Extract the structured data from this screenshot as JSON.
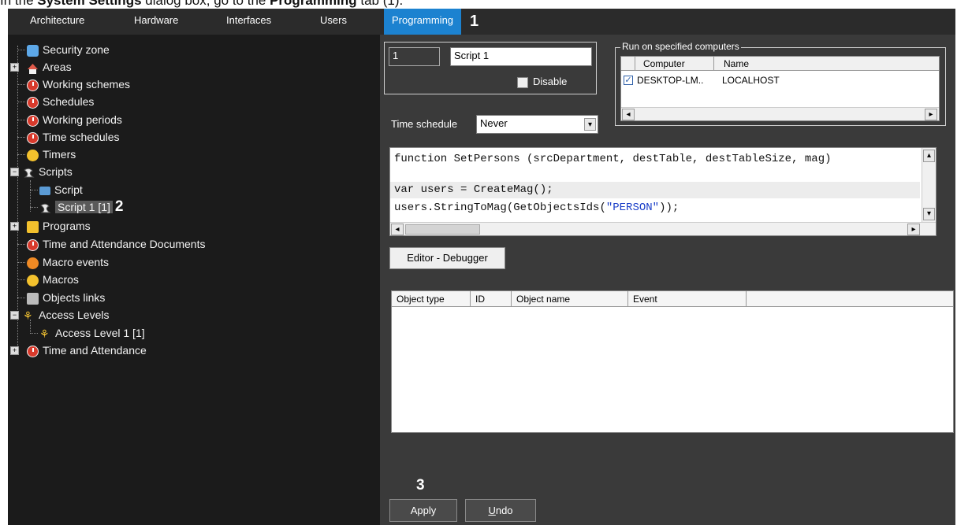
{
  "caption": {
    "prefix": "In the ",
    "dialog_name": "System Settings",
    "middle": " dialog box, go to the ",
    "tab_name": "Programming",
    "suffix": " tab (1)."
  },
  "tabs": [
    {
      "label": "Architecture"
    },
    {
      "label": "Hardware"
    },
    {
      "label": "Interfaces"
    },
    {
      "label": "Users"
    },
    {
      "label": "Programming",
      "active": true
    }
  ],
  "markers": {
    "tab": "1",
    "tree": "2",
    "apply": "3"
  },
  "tree": {
    "items": [
      {
        "label": "Security zone",
        "icon": "security-zone-icon"
      },
      {
        "label": "Areas",
        "icon": "areas-icon"
      },
      {
        "label": "Working schemes",
        "icon": "clock-icon"
      },
      {
        "label": "Schedules",
        "icon": "clock-icon"
      },
      {
        "label": "Working periods",
        "icon": "clock-icon"
      },
      {
        "label": "Time schedules",
        "icon": "clock-icon"
      },
      {
        "label": "Timers",
        "icon": "timer-icon"
      },
      {
        "label": "Scripts",
        "icon": "script-icon"
      },
      {
        "label": "Script",
        "icon": "folder-icon"
      },
      {
        "label": "Script 1 [1]",
        "icon": "script-icon",
        "selected": true
      },
      {
        "label": "Programs",
        "icon": "programs-icon"
      },
      {
        "label": "Time and Attendance Documents",
        "icon": "clock-icon"
      },
      {
        "label": "Macro events",
        "icon": "macro-event-icon"
      },
      {
        "label": "Macros",
        "icon": "macro-icon"
      },
      {
        "label": "Objects links",
        "icon": "link-icon"
      },
      {
        "label": "Access Levels",
        "icon": "access-icon"
      },
      {
        "label": "Access Level 1 [1]",
        "icon": "access-icon"
      },
      {
        "label": "Time and Attendance",
        "icon": "clock-icon"
      }
    ]
  },
  "form": {
    "id_value": "1",
    "name_value": "Script 1",
    "disable_label": "Disable",
    "run_on_group_label": "Run on specified computers",
    "computers_table": {
      "columns": [
        "Computer",
        "Name"
      ],
      "rows": [
        {
          "computer": "DESKTOP-LM..",
          "name": "LOCALHOST",
          "checked": true
        }
      ]
    },
    "time_schedule_label": "Time schedule",
    "time_schedule_value": "Never",
    "code_lines": [
      "function SetPersons (srcDepartment, destTable, destTableSize, mag)",
      "",
      "var users = CreateMag();",
      "users.StringToMag(GetObjectsIds(",
      "\"PERSON\"",
      "));"
    ],
    "editor_button": "Editor - Debugger",
    "events_table": {
      "columns": [
        "Object type",
        "ID",
        "Object name",
        "Event"
      ]
    },
    "apply_button": "Apply",
    "undo_button": "Undo"
  },
  "colors": {
    "active_tab": "#1c82d0",
    "panel_bg": "#1b1b1b",
    "right_bg": "#3a3a3a"
  }
}
